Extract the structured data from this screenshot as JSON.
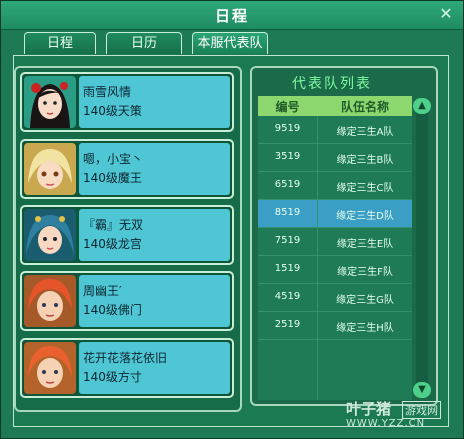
{
  "window": {
    "title": "日程",
    "close_glyph": "✕"
  },
  "tabs": [
    {
      "label": "日程",
      "active": false
    },
    {
      "label": "日历",
      "active": false
    },
    {
      "label": "本服代表队",
      "active": true
    }
  ],
  "players": [
    {
      "name": "雨雪风情",
      "level": "140级天策",
      "avatar": "avatar-black-hair-girl"
    },
    {
      "name": "嗯，小宝丶",
      "level": "140级魔王",
      "avatar": "avatar-blonde-child"
    },
    {
      "name": "『霸』无双",
      "level": "140级龙宫",
      "avatar": "avatar-blue-hair-girl"
    },
    {
      "name": "周幽王′",
      "level": "140级佛门",
      "avatar": "avatar-red-hair-boy"
    },
    {
      "name": "花开花落花依旧",
      "level": "140级方寸",
      "avatar": "avatar-red-hair-boy-2"
    }
  ],
  "team_list": {
    "title": "代表队列表",
    "col_id": "编号",
    "col_name": "队伍名称",
    "selected_index": 3,
    "rows": [
      {
        "id": "9519",
        "name": "缘定三生A队"
      },
      {
        "id": "3519",
        "name": "缘定三生B队"
      },
      {
        "id": "6519",
        "name": "缘定三生C队"
      },
      {
        "id": "8519",
        "name": "缘定三生D队"
      },
      {
        "id": "7519",
        "name": "缘定三生E队"
      },
      {
        "id": "1519",
        "name": "缘定三生F队"
      },
      {
        "id": "4519",
        "name": "缘定三生G队"
      },
      {
        "id": "2519",
        "name": "缘定三生H队"
      }
    ]
  },
  "scroll": {
    "up_glyph": "▲",
    "down_glyph": "▼"
  },
  "watermark": {
    "brand": "叶子猪",
    "tag": "游戏网",
    "url": "WWW.YZZ.CN"
  }
}
